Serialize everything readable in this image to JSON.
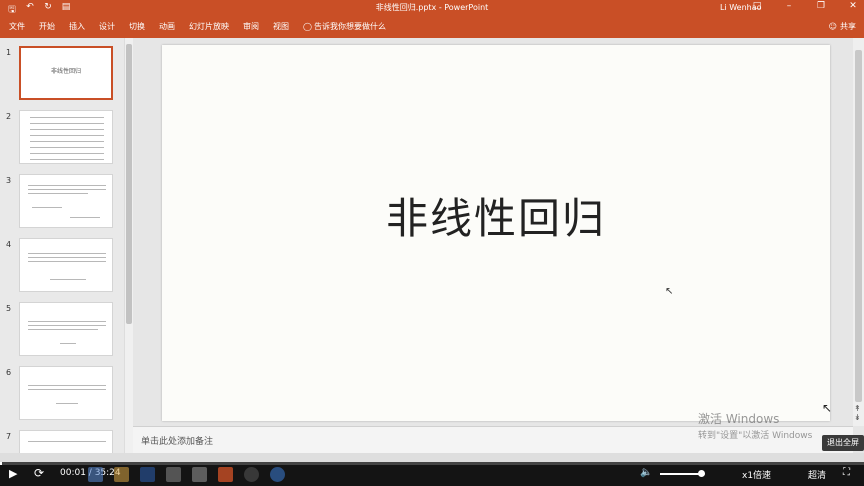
{
  "title_bar": {
    "doc_title": "非线性回归.pptx - PowerPoint",
    "user_name": "Li Wenhao",
    "quick_access": [
      "save-icon",
      "undo-icon",
      "redo-icon",
      "presenter-icon"
    ],
    "window_controls": [
      "ribbon-display-icon",
      "minimize-icon",
      "maximize-icon",
      "close-icon"
    ]
  },
  "ribbon": {
    "tabs": [
      "文件",
      "开始",
      "插入",
      "设计",
      "切换",
      "动画",
      "幻灯片放映",
      "审阅",
      "视图"
    ],
    "tell_me": "告诉我你想要做什么",
    "share": "共享"
  },
  "thumbnails": [
    {
      "number": "1",
      "title": "非线性回归",
      "selected": true
    },
    {
      "number": "2",
      "title": "",
      "selected": false
    },
    {
      "number": "3",
      "title": "",
      "selected": false
    },
    {
      "number": "4",
      "title": "",
      "selected": false
    },
    {
      "number": "5",
      "title": "",
      "selected": false
    },
    {
      "number": "6",
      "title": "",
      "selected": false
    },
    {
      "number": "7",
      "title": "",
      "selected": false
    }
  ],
  "slide": {
    "title": "非线性回归"
  },
  "notes": {
    "placeholder": "单击此处添加备注"
  },
  "watermark": {
    "line1": "激活 Windows",
    "line2": "转到\"设置\"以激活 Windows"
  },
  "exit_fullscreen": "退出全屏",
  "player": {
    "time": "00:01 / 35:24",
    "speed": "x1倍速",
    "quality": "超清",
    "progress": 0.0005,
    "volume": 0.9
  },
  "colors": {
    "accent": "#c94f26"
  }
}
